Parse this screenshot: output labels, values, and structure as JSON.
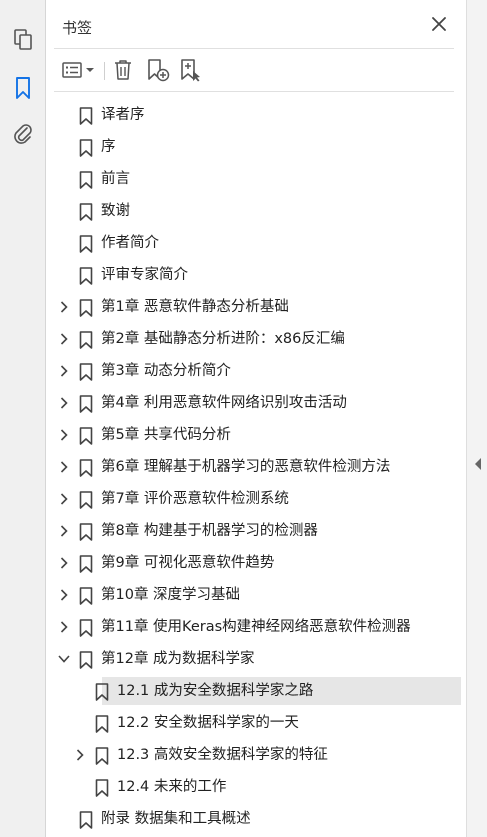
{
  "panel": {
    "title": "书签"
  },
  "rail": {
    "icons": [
      "pages-icon",
      "bookmark-icon",
      "attachment-icon"
    ],
    "active": "bookmark-icon"
  },
  "toolbar": {
    "icons": [
      "options-list-icon",
      "dropdown-arrow-icon",
      "delete-bookmark-icon",
      "new-bookmark-icon",
      "new-bookmark-from-selection-icon"
    ]
  },
  "colors": {
    "selected_bg": "#e6e6e6",
    "accent": "#1473e6",
    "text": "#222222"
  },
  "bookmarks": [
    {
      "label": "译者序",
      "level": 0,
      "expander": "none"
    },
    {
      "label": "序",
      "level": 0,
      "expander": "none"
    },
    {
      "label": "前言",
      "level": 0,
      "expander": "none"
    },
    {
      "label": "致谢",
      "level": 0,
      "expander": "none"
    },
    {
      "label": "作者简介",
      "level": 0,
      "expander": "none"
    },
    {
      "label": "评审专家简介",
      "level": 0,
      "expander": "none"
    },
    {
      "label": "第1章 恶意软件静态分析基础",
      "level": 0,
      "expander": "collapsed"
    },
    {
      "label": "第2章 基础静态分析进阶：x86反汇编",
      "level": 0,
      "expander": "collapsed"
    },
    {
      "label": "第3章 动态分析简介",
      "level": 0,
      "expander": "collapsed"
    },
    {
      "label": "第4章 利用恶意软件网络识别攻击活动",
      "level": 0,
      "expander": "collapsed"
    },
    {
      "label": "第5章 共享代码分析",
      "level": 0,
      "expander": "collapsed"
    },
    {
      "label": "第6章 理解基于机器学习的恶意软件检测方法",
      "level": 0,
      "expander": "collapsed"
    },
    {
      "label": "第7章 评价恶意软件检测系统",
      "level": 0,
      "expander": "collapsed"
    },
    {
      "label": "第8章 构建基于机器学习的检测器",
      "level": 0,
      "expander": "collapsed"
    },
    {
      "label": "第9章 可视化恶意软件趋势",
      "level": 0,
      "expander": "collapsed"
    },
    {
      "label": "第10章 深度学习基础",
      "level": 0,
      "expander": "collapsed"
    },
    {
      "label": "第11章 使用Keras构建神经网络恶意软件检测器",
      "level": 0,
      "expander": "collapsed"
    },
    {
      "label": "第12章 成为数据科学家",
      "level": 0,
      "expander": "expanded"
    },
    {
      "label": "12.1 成为安全数据科学家之路",
      "level": 1,
      "expander": "none",
      "selected": true
    },
    {
      "label": "12.2 安全数据科学家的一天",
      "level": 1,
      "expander": "none"
    },
    {
      "label": "12.3 高效安全数据科学家的特征",
      "level": 1,
      "expander": "collapsed"
    },
    {
      "label": "12.4 未来的工作",
      "level": 1,
      "expander": "none"
    },
    {
      "label": "附录 数据集和工具概述",
      "level": 0,
      "expander": "none"
    }
  ]
}
